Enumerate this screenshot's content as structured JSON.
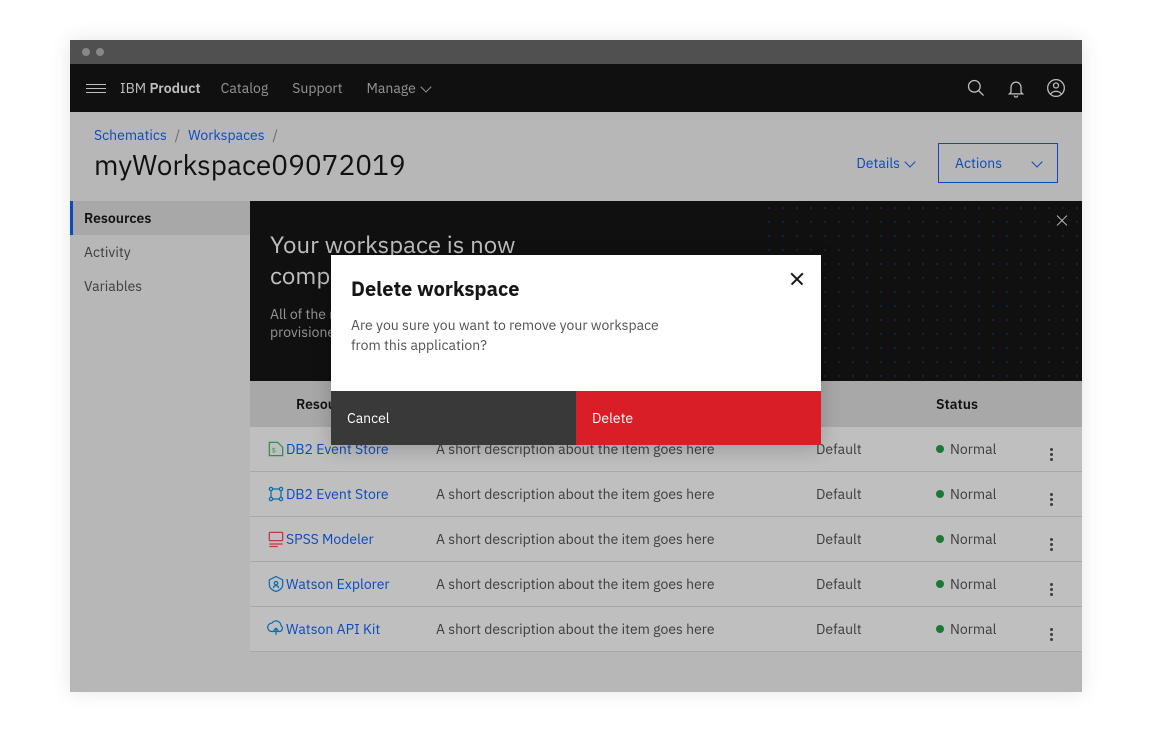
{
  "header": {
    "brand_prefix": "IBM",
    "brand_name": "Product",
    "nav": [
      "Catalog",
      "Support",
      "Manage"
    ]
  },
  "breadcrumbs": [
    "Schematics",
    "Workspaces"
  ],
  "page_title": "myWorkspace09072019",
  "details_label": "Details",
  "actions_label": "Actions",
  "sidebar": {
    "items": [
      {
        "label": "Resources",
        "active": true
      },
      {
        "label": "Activity",
        "active": false
      },
      {
        "label": "Variables",
        "active": false
      }
    ]
  },
  "banner": {
    "title": "Your workspace is now complete!",
    "text": "All of the resources have been provisioned."
  },
  "table": {
    "headers": {
      "name": "Resource",
      "plan": "",
      "status": "Status"
    },
    "rows": [
      {
        "name": "DB2 Event Store",
        "desc": "A short description about the item goes here",
        "plan": "Default",
        "status": "Normal"
      },
      {
        "name": "DB2 Event Store",
        "desc": "A short description about the item goes here",
        "plan": "Default",
        "status": "Normal"
      },
      {
        "name": "SPSS Modeler",
        "desc": "A short description about the item goes here",
        "plan": "Default",
        "status": "Normal"
      },
      {
        "name": "Watson Explorer",
        "desc": "A short description about the item goes here",
        "plan": "Default",
        "status": "Normal"
      },
      {
        "name": "Watson API Kit",
        "desc": "A short description about the item goes here",
        "plan": "Default",
        "status": "Normal"
      }
    ]
  },
  "modal": {
    "title": "Delete workspace",
    "text": "Are you sure you want to remove your workspace from this application?",
    "cancel": "Cancel",
    "delete": "Delete"
  }
}
